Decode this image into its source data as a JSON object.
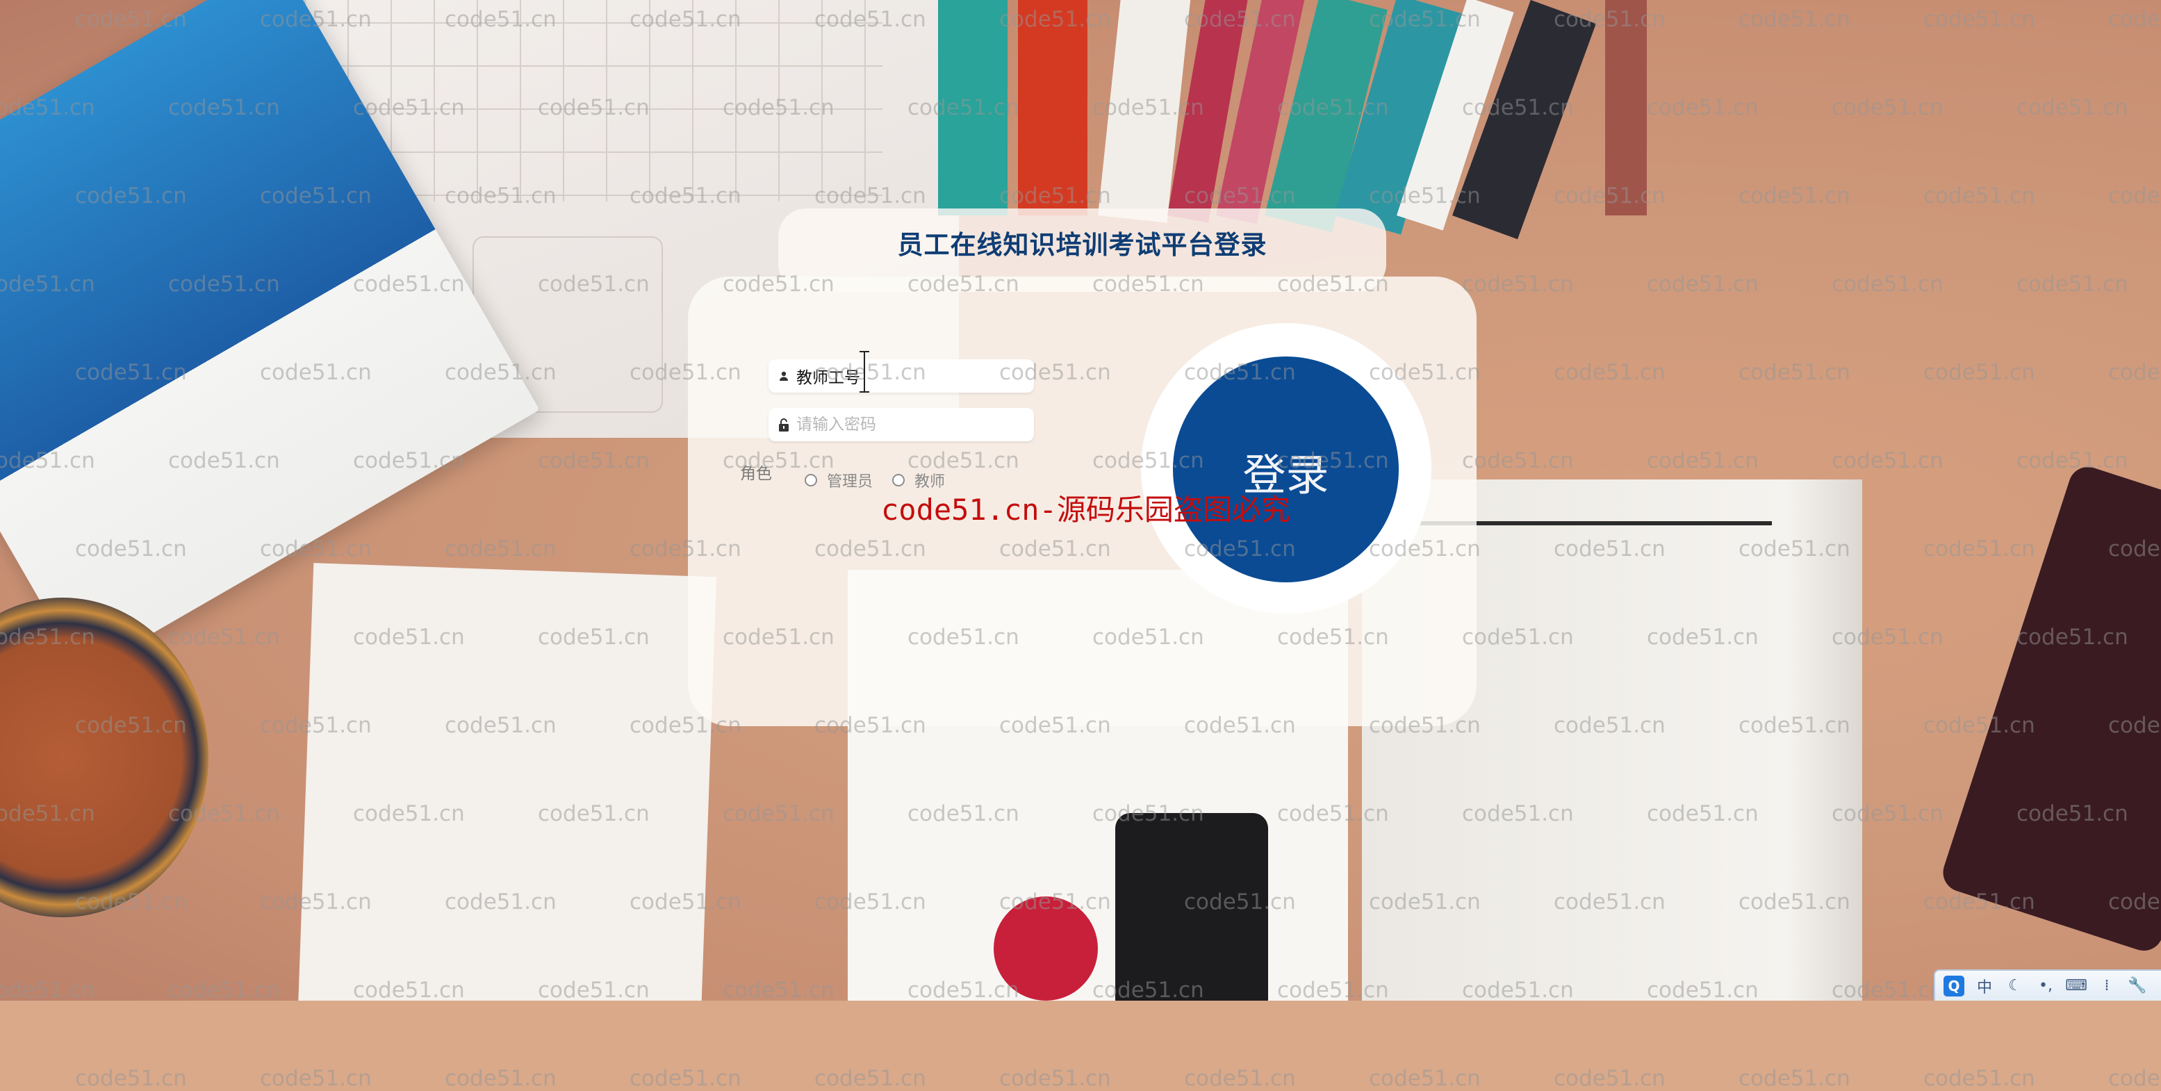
{
  "page": {
    "title": "员工在线知识培训考试平台登录"
  },
  "login_form": {
    "username": {
      "icon": "user-icon",
      "value": "教师工号",
      "placeholder": ""
    },
    "password": {
      "icon": "lock-icon",
      "value": "",
      "placeholder": "请输入密码"
    },
    "role": {
      "label": "角色",
      "options": [
        {
          "label": "管理员",
          "checked": false
        },
        {
          "label": "教师",
          "checked": false
        }
      ]
    },
    "submit_label": "登录"
  },
  "overlay": {
    "red_watermark": "code51.cn-源码乐园盗图必究",
    "tile_watermark": "code51.cn"
  },
  "ime_toolbar": {
    "items": [
      {
        "icon": "ime-logo-icon",
        "glyph": "Q"
      },
      {
        "icon": "chinese-mode-icon",
        "glyph": "中"
      },
      {
        "icon": "half-width-moon-icon",
        "glyph": "☾"
      },
      {
        "icon": "punctuation-icon",
        "glyph": "•,"
      },
      {
        "icon": "keyboard-icon",
        "glyph": "⌨"
      },
      {
        "icon": "voice-icon",
        "glyph": "⁞"
      },
      {
        "icon": "settings-wrench-icon",
        "glyph": "🔧"
      }
    ]
  },
  "colors": {
    "accent": "#0a4b94",
    "title": "#0f3d74",
    "red_watermark": "#c40d0d"
  }
}
